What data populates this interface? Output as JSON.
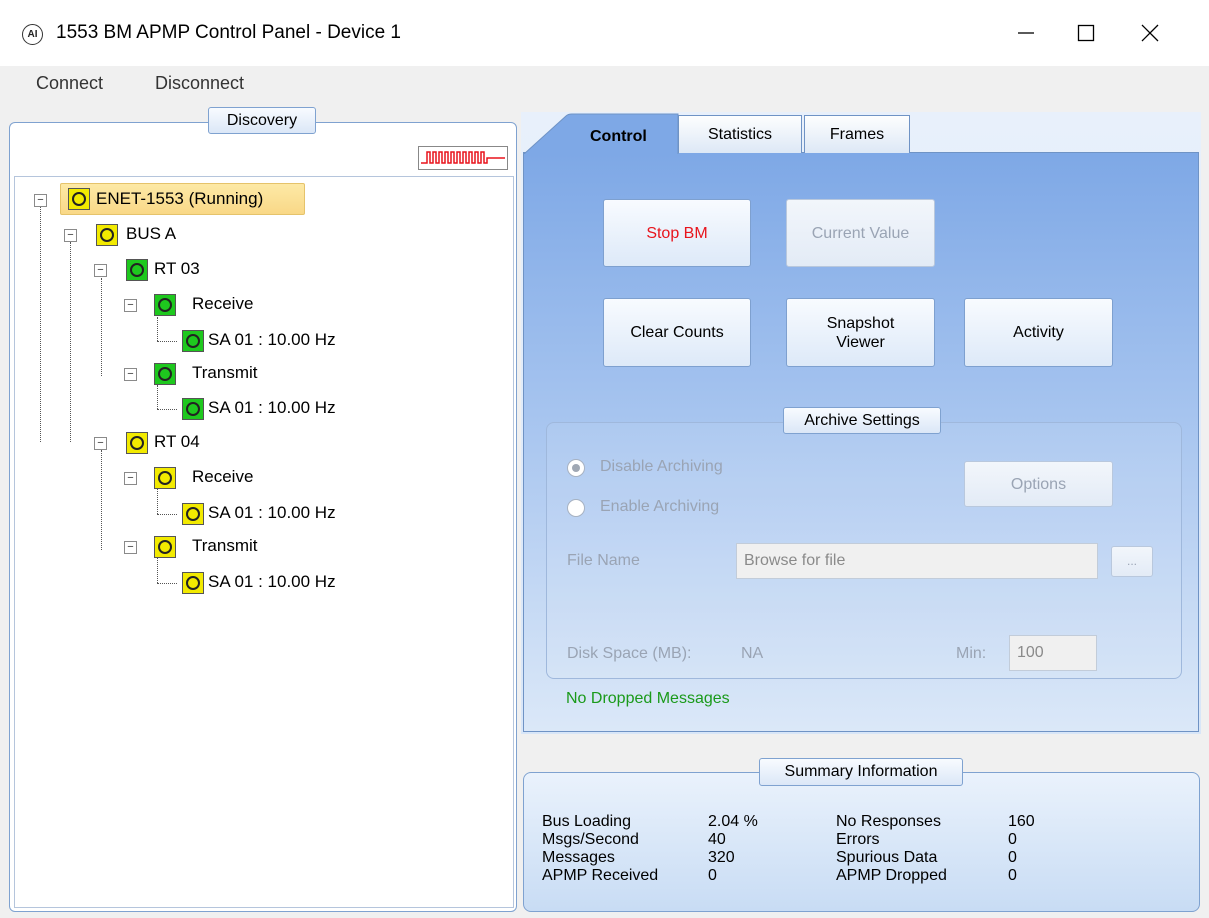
{
  "window": {
    "title": "1553 BM APMP Control Panel - Device 1",
    "icon_text": "AI",
    "minimize_label": "—",
    "maximize_label": "☐",
    "close_label": "✕"
  },
  "menu": {
    "items": [
      "Connect",
      "Disconnect"
    ]
  },
  "discovery": {
    "legend": "Discovery",
    "tree": {
      "root": "ENET-1553 (Running)",
      "bus": "BUS A",
      "rt03": "RT 03",
      "rt03_receive": "Receive",
      "rt03_receive_sa": "SA 01 : 10.00 Hz",
      "rt03_transmit": "Transmit",
      "rt03_transmit_sa": "SA 01 : 10.00 Hz",
      "rt04": "RT 04",
      "rt04_receive": "Receive",
      "rt04_receive_sa": "SA 01 : 10.00 Hz",
      "rt04_transmit": "Transmit",
      "rt04_transmit_sa": "SA 01 : 10.00 Hz"
    },
    "status_colors": {
      "running": "#f2ea00",
      "active": "#1ec81e"
    }
  },
  "tabs": {
    "control": "Control",
    "statistics": "Statistics",
    "frames": "Frames",
    "active": "Control"
  },
  "control": {
    "stop_bm": "Stop BM",
    "current_value": "Current Value",
    "clear_counts": "Clear Counts",
    "snapshot_line1": "Snapshot",
    "snapshot_line2": "Viewer",
    "activity": "Activity",
    "stop_color": "#e8141c"
  },
  "archive": {
    "legend": "Archive Settings",
    "disable_label": "Disable Archiving",
    "enable_label": "Enable Archiving",
    "options_label": "Options",
    "file_name_label": "File Name",
    "file_placeholder": "Browse for file",
    "browse_label": "...",
    "disk_space_label": "Disk Space (MB):",
    "disk_space_value": "NA",
    "min_label": "Min:",
    "min_value": "100"
  },
  "dropped_status": {
    "text": "No Dropped Messages",
    "color": "#1a9a1a"
  },
  "summary": {
    "legend": "Summary Information",
    "bus_loading_label": "Bus Loading",
    "bus_loading_value": "2.04 %",
    "msgs_per_second_label": "Msgs/Second",
    "msgs_per_second_value": "40",
    "messages_label": "Messages",
    "messages_value": "320",
    "apmp_received_label": "APMP Received",
    "apmp_received_value": "0",
    "no_responses_label": "No Responses",
    "no_responses_value": "160",
    "errors_label": "Errors",
    "errors_value": "0",
    "spurious_label": "Spurious Data",
    "spurious_value": "0",
    "apmp_dropped_label": "APMP Dropped",
    "apmp_dropped_value": "0"
  }
}
